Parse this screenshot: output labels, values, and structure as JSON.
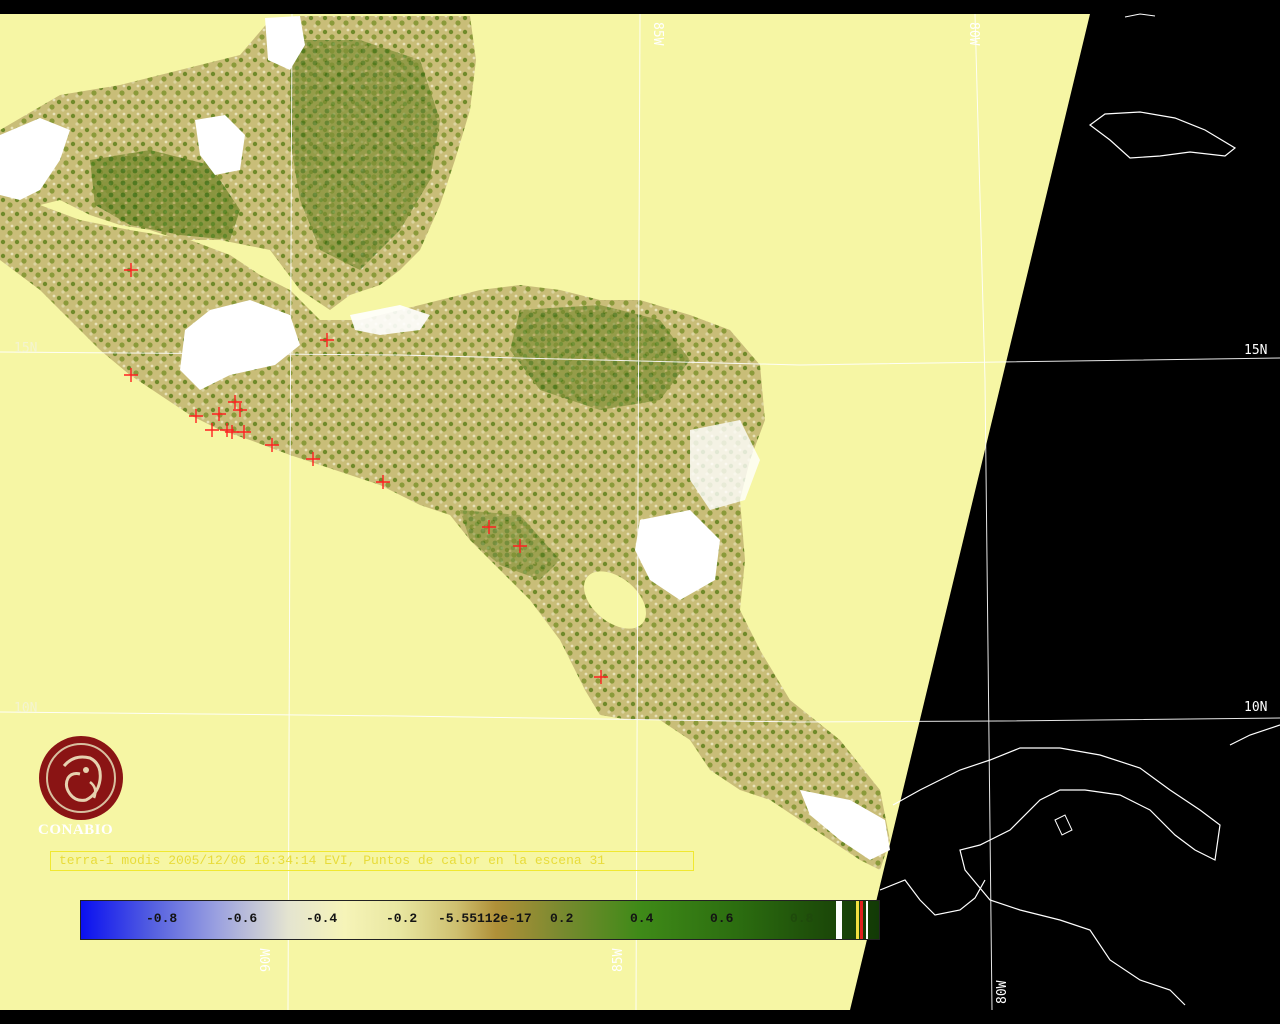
{
  "caption": "terra-1 modis 2005/12/06 16:34:14 EVI, Puntos de calor en la escena 31",
  "logo": {
    "text": "CONABIO"
  },
  "grid": {
    "lat_labels_left": [
      "15N",
      "10N"
    ],
    "lat_labels_right": [
      "15N",
      "10N"
    ],
    "lon_labels_top": [
      "85W",
      "80W"
    ],
    "lon_labels_bottom": [
      "90W",
      "85W",
      "80W"
    ]
  },
  "colorbar": {
    "ticks": [
      "-0.8",
      "-0.6",
      "-0.4",
      "-0.2",
      "-5.55112e-17",
      "0.2",
      "0.4",
      "0.6",
      "0.8"
    ],
    "low_color": "#0a10f0",
    "high_color": "#123a06"
  },
  "colors": {
    "water": "#f6f6a4",
    "background": "#000000",
    "hotspot": "#ff2020",
    "land_light": "#cfc27a",
    "land_green": "#4a7a18",
    "cloud": "#ffffff",
    "gridline": "#ffffff"
  }
}
